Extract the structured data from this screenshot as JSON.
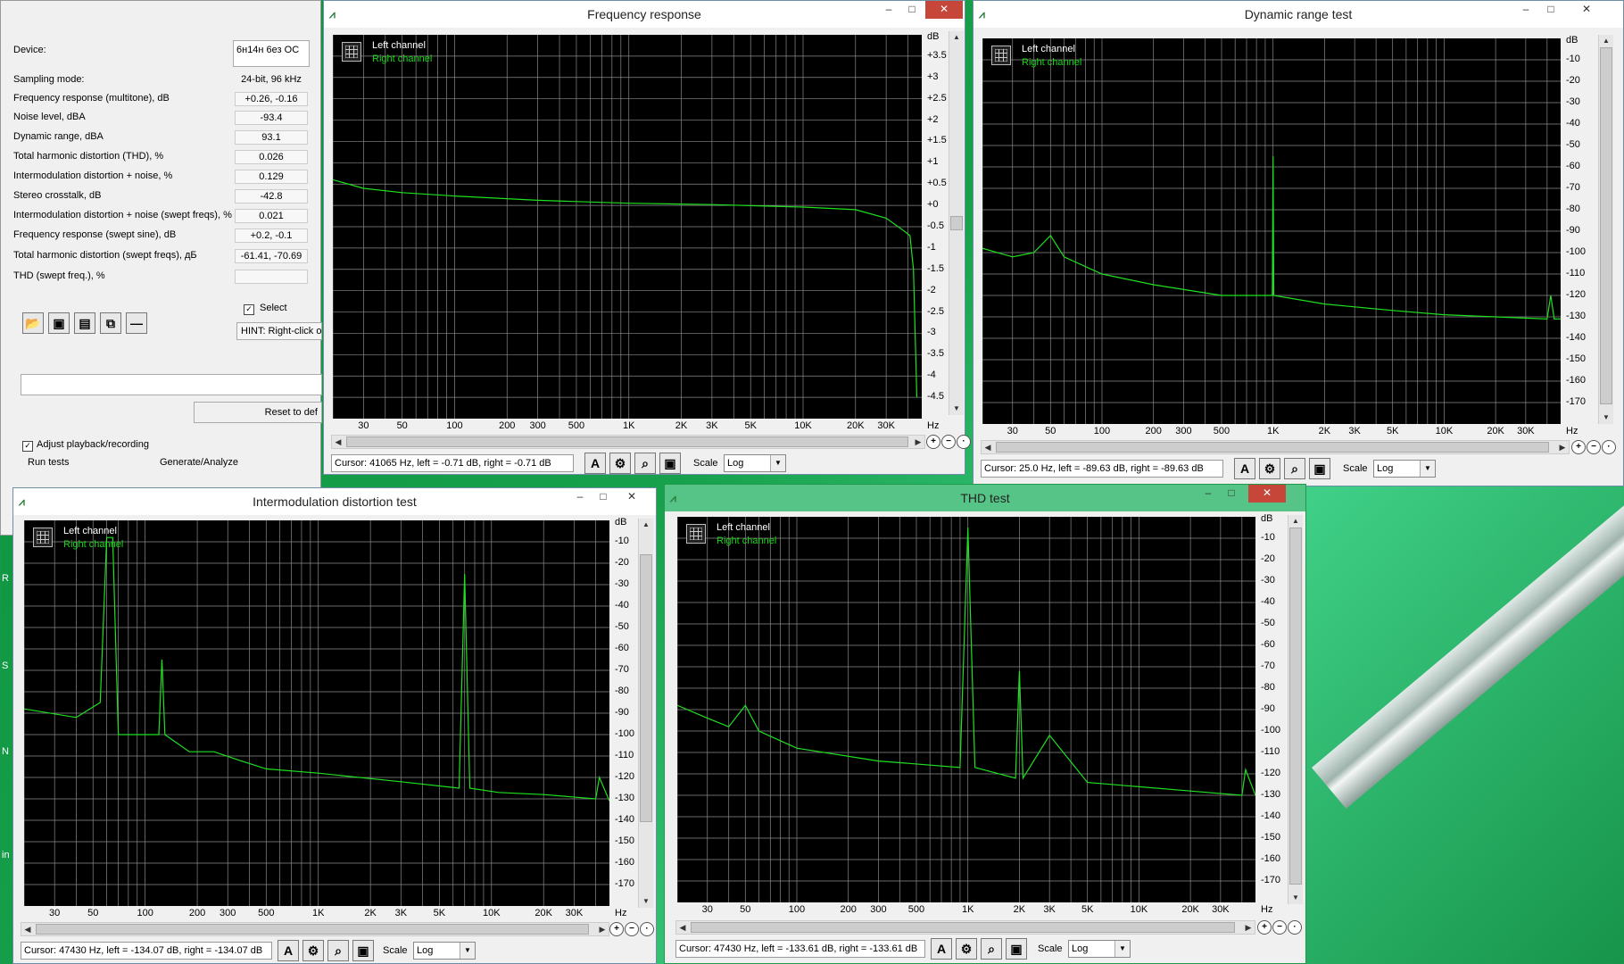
{
  "desktop": {
    "letters": [
      "R",
      "S",
      "N",
      "in"
    ]
  },
  "main_panel": {
    "device_label": "Device:",
    "device_value": "6н14н 6ез ОС",
    "rows": [
      {
        "label": "Sampling mode:",
        "value": "24-bit, 96 kHz"
      },
      {
        "label": "Frequency response (multitone), dB",
        "value": "+0.26, -0.16"
      },
      {
        "label": "Noise level, dBA",
        "value": "-93.4"
      },
      {
        "label": "Dynamic range, dBA",
        "value": "93.1"
      },
      {
        "label": "Total harmonic distortion (THD), %",
        "value": "0.026"
      },
      {
        "label": "Intermodulation distortion + noise, %",
        "value": "0.129"
      },
      {
        "label": "Stereo crosstalk, dB",
        "value": "-42.8"
      },
      {
        "label": "Intermodulation distortion + noise (swept freqs), %",
        "value": "0.021"
      },
      {
        "label": "Frequency response (swept sine), dB",
        "value": "+0.2, -0.1"
      },
      {
        "label": "Total harmonic distortion (swept freqs), дБ",
        "value": "-61.41, -70.69"
      },
      {
        "label": "THD (swept freq.), %",
        "value": ""
      }
    ],
    "select_label": "Select",
    "hint": "HINT: Right-click o",
    "reset_label": "Reset to def",
    "adjust_label": "Adjust playback/recording",
    "run_tests_label": "Run tests",
    "generate_label": "Generate/Analyze"
  },
  "common": {
    "left_channel": "Left channel",
    "right_channel": "Right channel",
    "scale_label": "Scale",
    "scale_value": "Log",
    "hz_label": "Hz",
    "db_label": "dB",
    "x_ticks": [
      "30",
      "50",
      "100",
      "200",
      "300",
      "500",
      "1K",
      "2K",
      "3K",
      "5K",
      "10K",
      "20K",
      "30K"
    ],
    "x_tick_freqs": [
      30,
      50,
      100,
      200,
      300,
      500,
      1000,
      2000,
      3000,
      5000,
      10000,
      20000,
      30000
    ],
    "color_trace": "#1fe01f",
    "color_grid": "#8a8a8a"
  },
  "windows": {
    "freq": {
      "title": "Frequency response",
      "cursor": "Cursor:  41065 Hz,  left = -0.71 dB,  right = -0.71 dB",
      "y_ticks": [
        "+3.5",
        "+3",
        "+2.5",
        "+2",
        "+1.5",
        "+1",
        "+0.5",
        "+0",
        "-0.5",
        "-1",
        "-1.5",
        "-2",
        "-2.5",
        "-3",
        "-3.5",
        "-4",
        "-4.5"
      ]
    },
    "dyn": {
      "title": "Dynamic range test",
      "cursor": "Cursor:  25.0 Hz,  left = -89.63 dB,  right = -89.63 dB",
      "y_ticks": [
        "-10",
        "-20",
        "-30",
        "-40",
        "-50",
        "-60",
        "-70",
        "-80",
        "-90",
        "-100",
        "-110",
        "-120",
        "-130",
        "-140",
        "-150",
        "-160",
        "-170"
      ]
    },
    "imd": {
      "title": "Intermodulation distortion test",
      "cursor": "Cursor:  47430 Hz,  left = -134.07 dB,  right = -134.07 dB",
      "y_ticks": [
        "-10",
        "-20",
        "-30",
        "-40",
        "-50",
        "-60",
        "-70",
        "-80",
        "-90",
        "-100",
        "-110",
        "-120",
        "-130",
        "-140",
        "-150",
        "-160",
        "-170"
      ]
    },
    "thd": {
      "title": "THD test",
      "cursor": "Cursor:  47430 Hz,  left = -133.61 dB,  right = -133.61 dB",
      "y_ticks": [
        "-10",
        "-20",
        "-30",
        "-40",
        "-50",
        "-60",
        "-70",
        "-80",
        "-90",
        "-100",
        "-110",
        "-120",
        "-130",
        "-140",
        "-150",
        "-160",
        "-170"
      ]
    }
  },
  "chart_data": [
    {
      "type": "line",
      "title": "Frequency response",
      "xscale": "log",
      "xlim": [
        20,
        48000
      ],
      "ylim": [
        -5,
        4
      ],
      "series": [
        {
          "name": "Left channel",
          "x": [
            20,
            30,
            50,
            100,
            300,
            1000,
            3000,
            10000,
            20000,
            30000,
            38000,
            41065,
            43000,
            45000
          ],
          "y": [
            0.6,
            0.4,
            0.3,
            0.22,
            0.12,
            0.05,
            0.02,
            -0.04,
            -0.1,
            -0.3,
            -0.6,
            -0.71,
            -1.5,
            -4.5
          ]
        }
      ]
    },
    {
      "type": "line",
      "title": "Dynamic range test",
      "xscale": "log",
      "xlim": [
        20,
        48000
      ],
      "ylim": [
        -180,
        0
      ],
      "series": [
        {
          "name": "Left channel",
          "x": [
            20,
            30,
            40,
            50,
            60,
            100,
            200,
            500,
            990,
            1000,
            1010,
            2000,
            5000,
            10000,
            20000,
            40000,
            42000,
            44000,
            48000
          ],
          "y": [
            -98,
            -102,
            -100,
            -92,
            -102,
            -110,
            -115,
            -120,
            -120,
            -55,
            -120,
            -124,
            -127,
            -129,
            -130,
            -131,
            -120,
            -131,
            -131
          ]
        }
      ]
    },
    {
      "type": "line",
      "title": "Intermodulation distortion test",
      "xscale": "log",
      "xlim": [
        20,
        48000
      ],
      "ylim": [
        -180,
        0
      ],
      "series": [
        {
          "name": "Left channel",
          "x": [
            20,
            40,
            55,
            60,
            65,
            70,
            120,
            125,
            130,
            180,
            250,
            350,
            500,
            1000,
            3000,
            6500,
            7000,
            7500,
            11000,
            20000,
            40000,
            42000,
            48000
          ],
          "y": [
            -88,
            -92,
            -85,
            -8,
            -8,
            -100,
            -100,
            -65,
            -100,
            -108,
            -108,
            -112,
            -116,
            -118,
            -122,
            -125,
            -25,
            -125,
            -127,
            -128,
            -130,
            -120,
            -131
          ]
        }
      ]
    },
    {
      "type": "line",
      "title": "THD test",
      "xscale": "log",
      "xlim": [
        20,
        48000
      ],
      "ylim": [
        -180,
        0
      ],
      "series": [
        {
          "name": "Left channel",
          "x": [
            20,
            30,
            40,
            50,
            60,
            100,
            300,
            900,
            1000,
            1100,
            1900,
            2000,
            2100,
            3000,
            5000,
            10000,
            20000,
            40000,
            42000,
            48000
          ],
          "y": [
            -88,
            -94,
            -98,
            -88,
            -100,
            -108,
            -114,
            -117,
            -5,
            -117,
            -122,
            -72,
            -122,
            -102,
            -124,
            -126,
            -128,
            -130,
            -118,
            -130
          ]
        }
      ]
    }
  ]
}
